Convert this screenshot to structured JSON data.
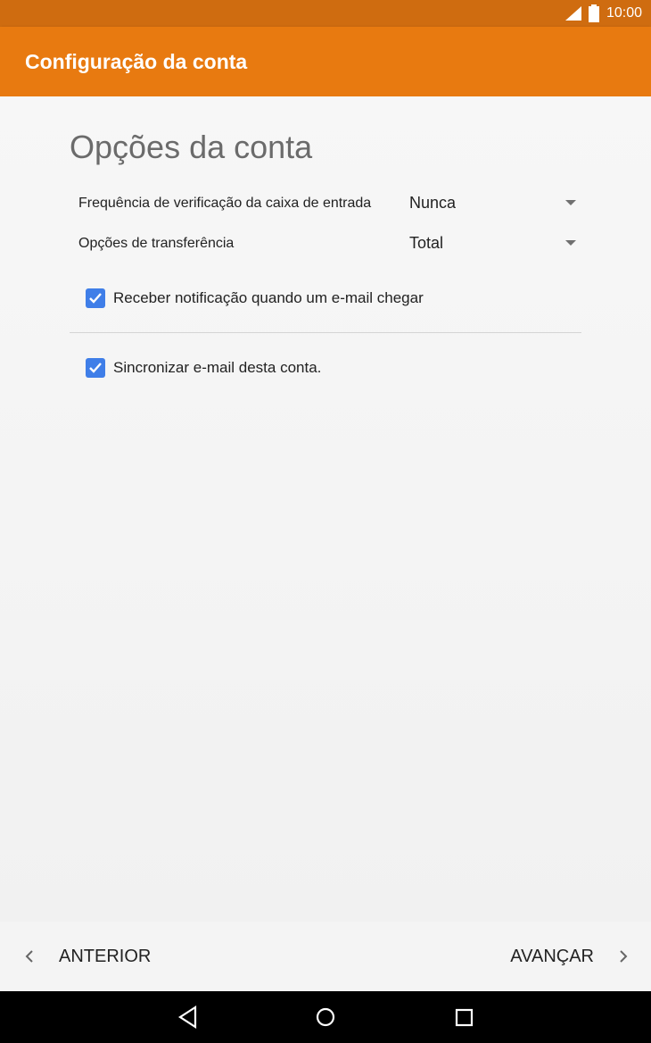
{
  "status": {
    "time": "10:00"
  },
  "appbar": {
    "title": "Configuração da conta"
  },
  "main": {
    "section_title": "Opções da conta",
    "settings": [
      {
        "label": "Frequência de verificação da caixa de entrada",
        "value": "Nunca"
      },
      {
        "label": "Opções de transferência",
        "value": "Total"
      }
    ],
    "checkboxes": [
      {
        "label": "Receber notificação quando um e-mail chegar",
        "checked": true
      },
      {
        "label": "Sincronizar e-mail desta conta.",
        "checked": true
      }
    ]
  },
  "footer": {
    "back_label": "ANTERIOR",
    "next_label": "AVANÇAR"
  },
  "colors": {
    "statusbar": "#cf6c10",
    "appbar": "#e87a10",
    "checkbox": "#3f7ee8"
  }
}
